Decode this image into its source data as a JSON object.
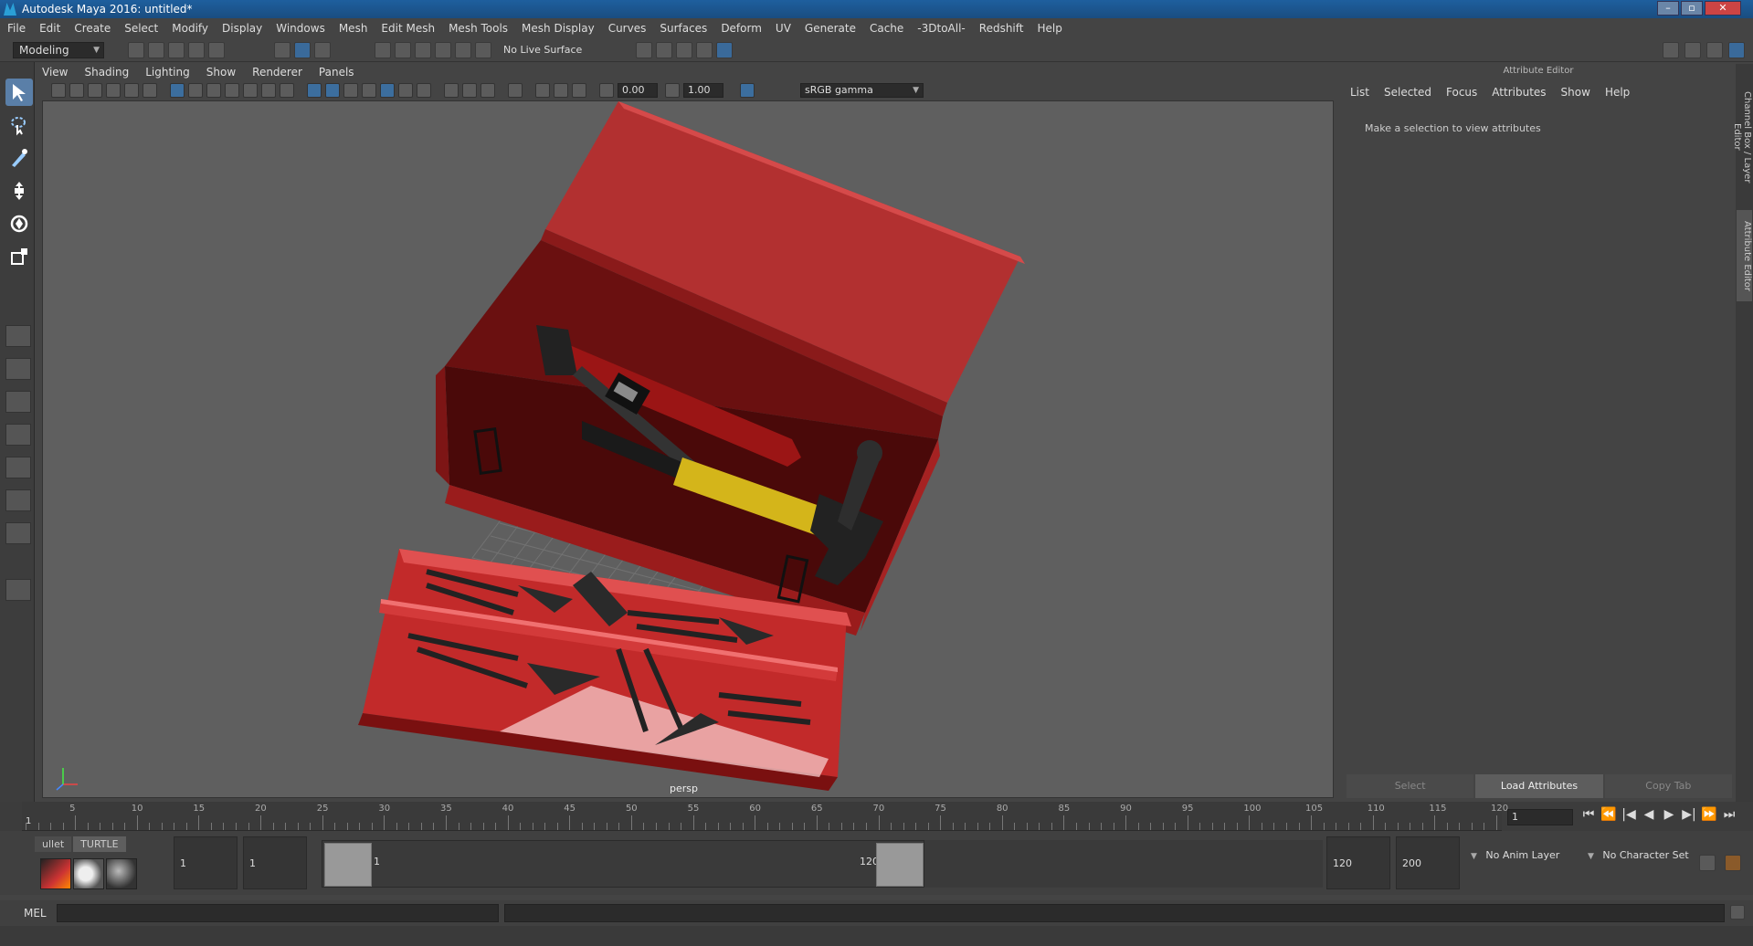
{
  "window": {
    "title": "Autodesk Maya 2016: untitled*",
    "controls": [
      "–",
      "▫",
      "✕"
    ]
  },
  "menubar": [
    "File",
    "Edit",
    "Create",
    "Select",
    "Modify",
    "Display",
    "Windows",
    "Mesh",
    "Edit Mesh",
    "Mesh Tools",
    "Mesh Display",
    "Curves",
    "Surfaces",
    "Deform",
    "UV",
    "Generate",
    "Cache",
    "-3DtoAll-",
    "Redshift",
    "Help"
  ],
  "toolbar": {
    "mode": "Modeling",
    "live_surface": "No Live Surface"
  },
  "panel": {
    "menu": [
      "View",
      "Shading",
      "Lighting",
      "Show",
      "Renderer",
      "Panels"
    ],
    "exposure": "0.00",
    "gamma": "1.00",
    "color_space": "sRGB gamma",
    "camera_label": "persp"
  },
  "attribute_editor": {
    "title": "Attribute Editor",
    "menu": [
      "List",
      "Selected",
      "Focus",
      "Attributes",
      "Show",
      "Help"
    ],
    "message": "Make a selection to view attributes",
    "buttons": [
      "Select",
      "Load Attributes",
      "Copy Tab"
    ]
  },
  "side_tabs": [
    "Channel Box / Layer Editor",
    "Attribute Editor"
  ],
  "timeline": {
    "ticks": [
      5,
      10,
      15,
      20,
      25,
      30,
      35,
      40,
      45,
      50,
      55,
      60,
      65,
      70,
      75,
      80,
      85,
      90,
      95,
      100,
      105,
      110,
      115,
      120
    ],
    "current_frame": "1",
    "frame_field": "1",
    "playback": [
      "⏮",
      "⏪",
      "|◀",
      "◀",
      "▶",
      "▶|",
      "⏩",
      "⏭"
    ]
  },
  "range": {
    "shelf_tabs": [
      "ullet",
      "TURTLE"
    ],
    "start_field": "1",
    "range_start_field": "1",
    "range_start_label": "1",
    "range_end_label": "120",
    "range_end_field": "120",
    "end_field": "200",
    "anim_layer": "No Anim Layer",
    "character_set": "No Character Set"
  },
  "command_line": {
    "label": "MEL"
  },
  "colors": {
    "viewport_bg": "#5f5f5f",
    "accent": "#5a7fa8",
    "toolbox_red": "#b22222"
  }
}
